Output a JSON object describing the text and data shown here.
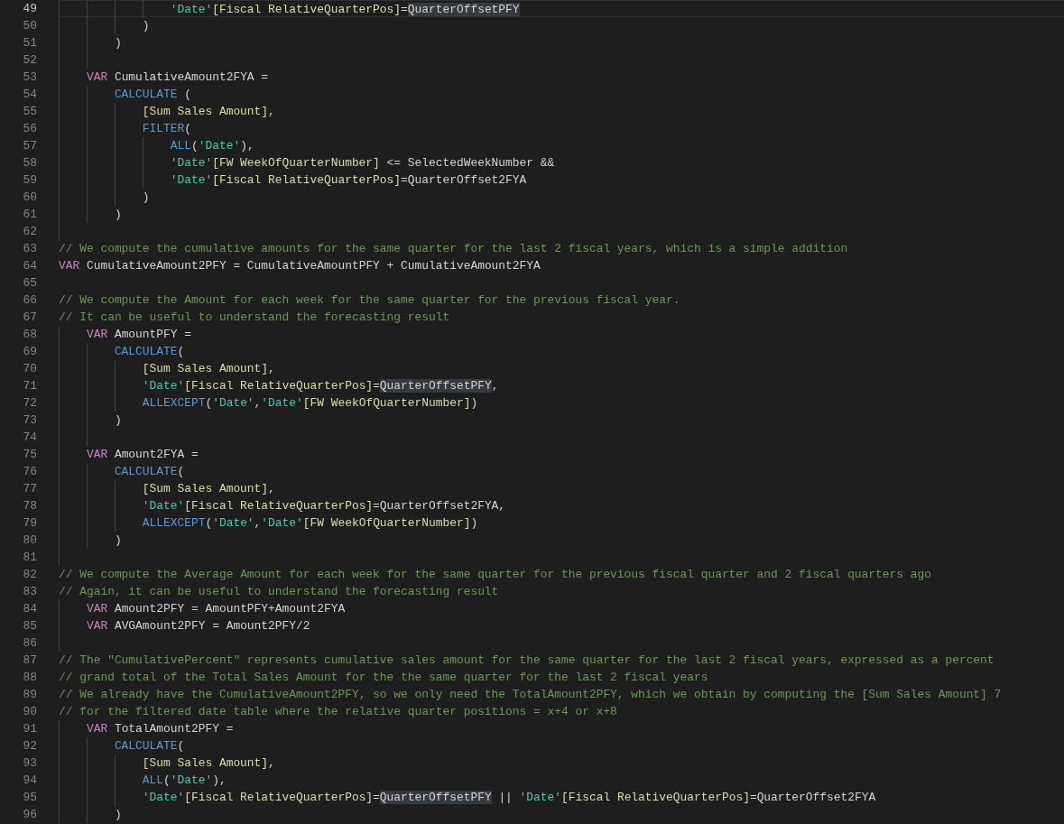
{
  "editor": {
    "lines": [
      {
        "number": "49",
        "selected": true,
        "tokens": [
          {
            "kind": "table",
            "text": "                'Date'"
          },
          {
            "kind": "column",
            "text": "[Fiscal RelativeQuarterPos]"
          },
          {
            "kind": "plain",
            "text": "="
          },
          {
            "kind": "match",
            "text": "QuarterOffsetPFY"
          }
        ]
      },
      {
        "number": "50",
        "selected": false,
        "tokens": [
          {
            "kind": "plain",
            "text": "            )"
          }
        ]
      },
      {
        "number": "51",
        "selected": false,
        "tokens": [
          {
            "kind": "plain",
            "text": "        )"
          }
        ]
      },
      {
        "number": "52",
        "selected": false
      },
      {
        "number": "53",
        "selected": false,
        "tokens": [
          {
            "kind": "keyword",
            "text": "    VAR"
          },
          {
            "kind": "plain",
            "text": " CumulativeAmount2FYA ="
          }
        ]
      },
      {
        "number": "54",
        "selected": false,
        "tokens": [
          {
            "kind": "function",
            "text": "        CALCULATE"
          },
          {
            "kind": "plain",
            "text": " ("
          }
        ]
      },
      {
        "number": "55",
        "selected": false,
        "tokens": [
          {
            "kind": "column",
            "text": "            [Sum Sales Amount]"
          },
          {
            "kind": "plain",
            "text": ","
          }
        ]
      },
      {
        "number": "56",
        "selected": false,
        "tokens": [
          {
            "kind": "function",
            "text": "            FILTER"
          },
          {
            "kind": "plain",
            "text": "("
          }
        ]
      },
      {
        "number": "57",
        "selected": false,
        "tokens": [
          {
            "kind": "function",
            "text": "                ALL"
          },
          {
            "kind": "plain",
            "text": "("
          },
          {
            "kind": "table",
            "text": "'Date'"
          },
          {
            "kind": "plain",
            "text": "),"
          }
        ]
      },
      {
        "number": "58",
        "selected": false,
        "tokens": [
          {
            "kind": "table",
            "text": "                'Date'"
          },
          {
            "kind": "column",
            "text": "[FW WeekOfQuarterNumber]"
          },
          {
            "kind": "plain",
            "text": " <= SelectedWeekNumber &&"
          }
        ]
      },
      {
        "number": "59",
        "selected": false,
        "tokens": [
          {
            "kind": "table",
            "text": "                'Date'"
          },
          {
            "kind": "column",
            "text": "[Fiscal RelativeQuarterPos]"
          },
          {
            "kind": "plain",
            "text": "=QuarterOffset2FYA"
          }
        ]
      },
      {
        "number": "60",
        "selected": false,
        "tokens": [
          {
            "kind": "plain",
            "text": "            )"
          }
        ]
      },
      {
        "number": "61",
        "selected": false,
        "tokens": [
          {
            "kind": "plain",
            "text": "        )"
          }
        ]
      },
      {
        "number": "62",
        "selected": false
      },
      {
        "number": "63",
        "selected": false,
        "tokens": [
          {
            "kind": "comment",
            "text": "// We compute the cumulative amounts for the same quarter for the last 2 fiscal years, which is a simple addition"
          }
        ]
      },
      {
        "number": "64",
        "selected": false,
        "tokens": [
          {
            "kind": "keyword",
            "text": "VAR"
          },
          {
            "kind": "plain",
            "text": " CumulativeAmount2PFY = CumulativeAmountPFY + CumulativeAmount2FYA"
          }
        ]
      },
      {
        "number": "65",
        "selected": false
      },
      {
        "number": "66",
        "selected": false,
        "tokens": [
          {
            "kind": "comment",
            "text": "// We compute the Amount for each week for the same quarter for the previous fiscal year."
          }
        ]
      },
      {
        "number": "67",
        "selected": false,
        "tokens": [
          {
            "kind": "comment",
            "text": "// It can be useful to understand the forecasting result"
          }
        ]
      },
      {
        "number": "68",
        "selected": false,
        "tokens": [
          {
            "kind": "keyword",
            "text": "    VAR"
          },
          {
            "kind": "plain",
            "text": " AmountPFY ="
          }
        ]
      },
      {
        "number": "69",
        "selected": false,
        "tokens": [
          {
            "kind": "function",
            "text": "        CALCULATE"
          },
          {
            "kind": "plain",
            "text": "("
          }
        ]
      },
      {
        "number": "70",
        "selected": false,
        "tokens": [
          {
            "kind": "column",
            "text": "            [Sum Sales Amount]"
          },
          {
            "kind": "plain",
            "text": ","
          }
        ]
      },
      {
        "number": "71",
        "selected": false,
        "tokens": [
          {
            "kind": "table",
            "text": "            'Date'"
          },
          {
            "kind": "column",
            "text": "[Fiscal RelativeQuarterPos]"
          },
          {
            "kind": "plain",
            "text": "="
          },
          {
            "kind": "match",
            "text": "QuarterOffsetPFY"
          },
          {
            "kind": "plain",
            "text": ","
          }
        ]
      },
      {
        "number": "72",
        "selected": false,
        "tokens": [
          {
            "kind": "function",
            "text": "            ALLEXCEPT"
          },
          {
            "kind": "plain",
            "text": "("
          },
          {
            "kind": "table",
            "text": "'Date'"
          },
          {
            "kind": "plain",
            "text": ","
          },
          {
            "kind": "table",
            "text": "'Date'"
          },
          {
            "kind": "column",
            "text": "[FW WeekOfQuarterNumber]"
          },
          {
            "kind": "plain",
            "text": ")"
          }
        ]
      },
      {
        "number": "73",
        "selected": false,
        "tokens": [
          {
            "kind": "plain",
            "text": "        )"
          }
        ]
      },
      {
        "number": "74",
        "selected": false
      },
      {
        "number": "75",
        "selected": false,
        "tokens": [
          {
            "kind": "keyword",
            "text": "    VAR"
          },
          {
            "kind": "plain",
            "text": " Amount2FYA ="
          }
        ]
      },
      {
        "number": "76",
        "selected": false,
        "tokens": [
          {
            "kind": "function",
            "text": "        CALCULATE"
          },
          {
            "kind": "plain",
            "text": "("
          }
        ]
      },
      {
        "number": "77",
        "selected": false,
        "tokens": [
          {
            "kind": "column",
            "text": "            [Sum Sales Amount]"
          },
          {
            "kind": "plain",
            "text": ","
          }
        ]
      },
      {
        "number": "78",
        "selected": false,
        "tokens": [
          {
            "kind": "table",
            "text": "            'Date'"
          },
          {
            "kind": "column",
            "text": "[Fiscal RelativeQuarterPos]"
          },
          {
            "kind": "plain",
            "text": "=QuarterOffset2FYA,"
          }
        ]
      },
      {
        "number": "79",
        "selected": false,
        "tokens": [
          {
            "kind": "function",
            "text": "            ALLEXCEPT"
          },
          {
            "kind": "plain",
            "text": "("
          },
          {
            "kind": "table",
            "text": "'Date'"
          },
          {
            "kind": "plain",
            "text": ","
          },
          {
            "kind": "table",
            "text": "'Date'"
          },
          {
            "kind": "column",
            "text": "[FW WeekOfQuarterNumber]"
          },
          {
            "kind": "plain",
            "text": ")"
          }
        ]
      },
      {
        "number": "80",
        "selected": false,
        "tokens": [
          {
            "kind": "plain",
            "text": "        )"
          }
        ]
      },
      {
        "number": "81",
        "selected": false
      },
      {
        "number": "82",
        "selected": false,
        "tokens": [
          {
            "kind": "comment",
            "text": "// We compute the Average Amount for each week for the same quarter for the previous fiscal quarter and 2 fiscal quarters ago"
          }
        ]
      },
      {
        "number": "83",
        "selected": false,
        "tokens": [
          {
            "kind": "comment",
            "text": "// Again, it can be useful to understand the forecasting result"
          }
        ]
      },
      {
        "number": "84",
        "selected": false,
        "tokens": [
          {
            "kind": "keyword",
            "text": "    VAR"
          },
          {
            "kind": "plain",
            "text": " Amount2PFY = AmountPFY+Amount2FYA"
          }
        ]
      },
      {
        "number": "85",
        "selected": false,
        "tokens": [
          {
            "kind": "keyword",
            "text": "    VAR"
          },
          {
            "kind": "plain",
            "text": " AVGAmount2PFY = Amount2PFY/2"
          }
        ]
      },
      {
        "number": "86",
        "selected": false
      },
      {
        "number": "87",
        "selected": false,
        "tokens": [
          {
            "kind": "comment",
            "text": "// The \"CumulativePercent\" represents cumulative sales amount for the same quarter for the last 2 fiscal years, expressed as a percent"
          }
        ]
      },
      {
        "number": "88",
        "selected": false,
        "tokens": [
          {
            "kind": "comment",
            "text": "// grand total of the Total Sales Amount for the the same quarter for the last 2 fiscal years"
          }
        ]
      },
      {
        "number": "89",
        "selected": false,
        "tokens": [
          {
            "kind": "comment",
            "text": "// We already have the CumulativeAmount2PFY, so we only need the TotalAmount2PFY, which we obtain by computing the [Sum Sales Amount] 7"
          }
        ]
      },
      {
        "number": "90",
        "selected": false,
        "tokens": [
          {
            "kind": "comment",
            "text": "// for the filtered date table where the relative quarter positions = x+4 or x+8"
          }
        ]
      },
      {
        "number": "91",
        "selected": false,
        "tokens": [
          {
            "kind": "keyword",
            "text": "    VAR"
          },
          {
            "kind": "plain",
            "text": " TotalAmount2PFY ="
          }
        ]
      },
      {
        "number": "92",
        "selected": false,
        "tokens": [
          {
            "kind": "function",
            "text": "        CALCULATE"
          },
          {
            "kind": "plain",
            "text": "("
          }
        ]
      },
      {
        "number": "93",
        "selected": false,
        "tokens": [
          {
            "kind": "column",
            "text": "            [Sum Sales Amount]"
          },
          {
            "kind": "plain",
            "text": ","
          }
        ]
      },
      {
        "number": "94",
        "selected": false,
        "tokens": [
          {
            "kind": "function",
            "text": "            ALL"
          },
          {
            "kind": "plain",
            "text": "("
          },
          {
            "kind": "table",
            "text": "'Date'"
          },
          {
            "kind": "plain",
            "text": "),"
          }
        ]
      },
      {
        "number": "95",
        "selected": false,
        "tokens": [
          {
            "kind": "table",
            "text": "            'Date'"
          },
          {
            "kind": "column",
            "text": "[Fiscal RelativeQuarterPos]"
          },
          {
            "kind": "plain",
            "text": "="
          },
          {
            "kind": "match",
            "text": "QuarterOffsetPFY"
          },
          {
            "kind": "plain",
            "text": " || "
          },
          {
            "kind": "table",
            "text": "'Date'"
          },
          {
            "kind": "column",
            "text": "[Fiscal RelativeQuarterPos]"
          },
          {
            "kind": "plain",
            "text": "=QuarterOffset2FYA"
          }
        ]
      },
      {
        "number": "96",
        "selected": false,
        "tokens": [
          {
            "kind": "plain",
            "text": "        )"
          }
        ]
      }
    ]
  }
}
